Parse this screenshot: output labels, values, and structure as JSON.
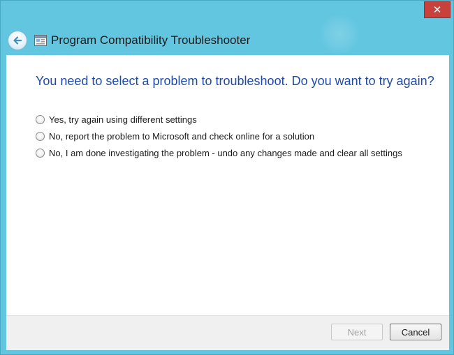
{
  "window": {
    "title": "Program Compatibility Troubleshooter",
    "close_glyph": "✕"
  },
  "main": {
    "heading": "You need to select a problem to troubleshoot.  Do you want to try again?",
    "options": [
      {
        "label": "Yes, try again using different settings",
        "selected": false
      },
      {
        "label": "No, report the problem to Microsoft and check online for a solution",
        "selected": false
      },
      {
        "label": "No, I am done investigating the problem - undo any changes made and clear all settings",
        "selected": false
      }
    ]
  },
  "footer": {
    "next_label": "Next",
    "next_enabled": false,
    "cancel_label": "Cancel"
  },
  "icons": {
    "back": "back-arrow-icon",
    "app": "troubleshooter-app-icon",
    "close": "close-icon"
  },
  "colors": {
    "frame": "#62c6e0",
    "heading": "#1f4aa8",
    "close_button": "#c8413a"
  }
}
